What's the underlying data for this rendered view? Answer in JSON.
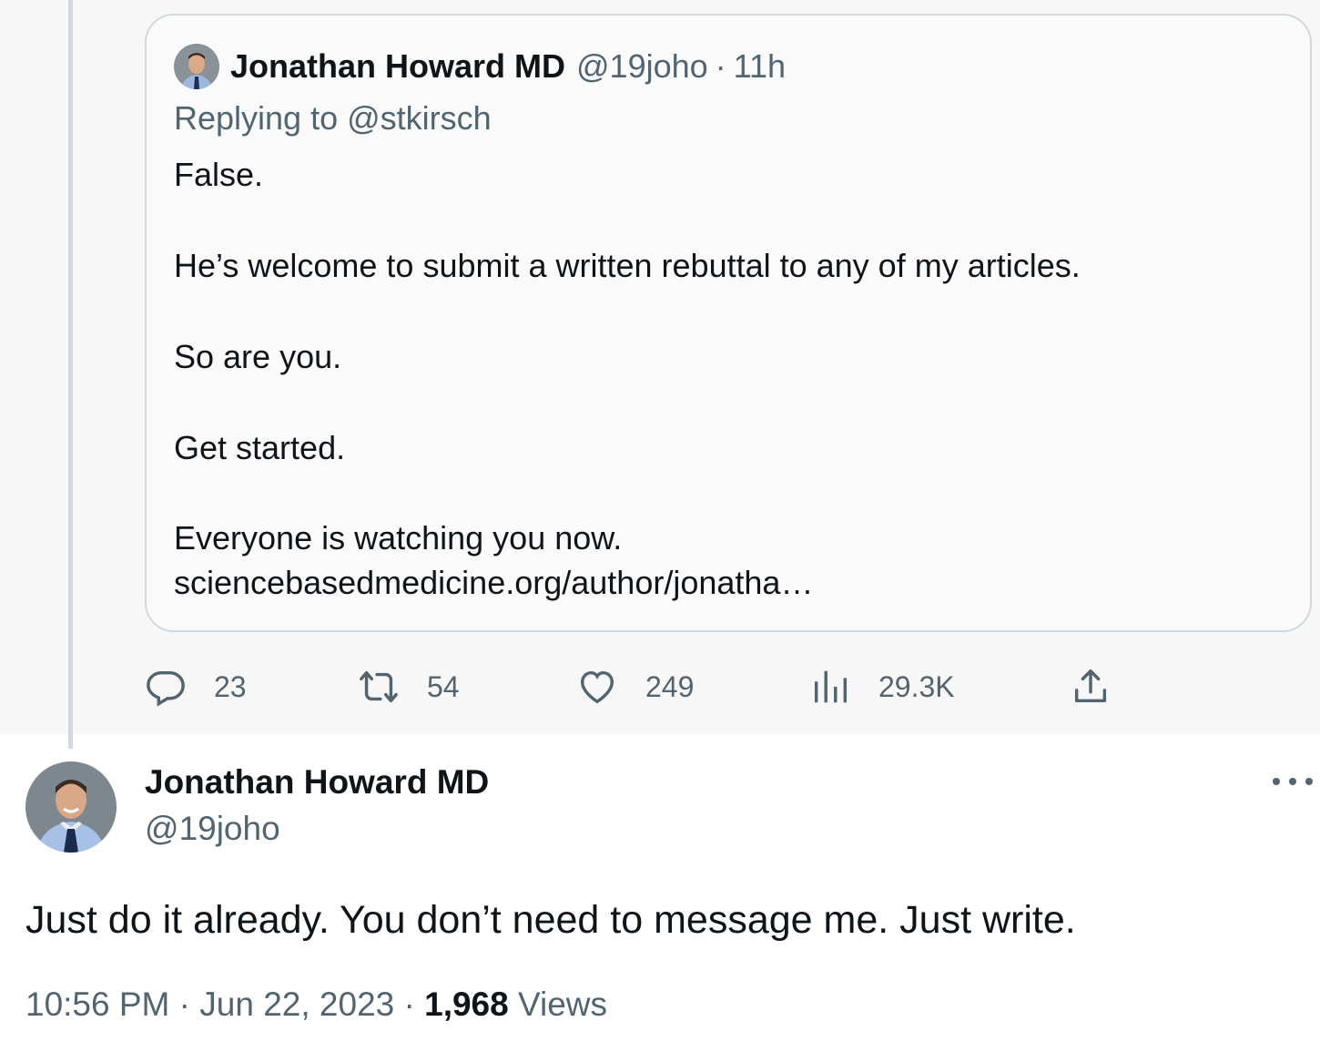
{
  "colors": {
    "text_primary": "#0f1419",
    "text_secondary": "#536471",
    "border": "#cfd9de",
    "parent_bg": "#f7f7f7"
  },
  "quoted_tweet": {
    "author_name": "Jonathan Howard MD",
    "handle": "@19joho",
    "separator": "·",
    "time": "11h",
    "replying_to": "Replying to @stkirsch",
    "lines": [
      "False.",
      "He’s welcome to submit a written rebuttal to any of my articles.",
      "So are you.",
      "Get started.",
      "Everyone is watching you now.",
      "sciencebasedmedicine.org/author/jonatha…"
    ],
    "actions": {
      "reply_count": "23",
      "repost_count": "54",
      "like_count": "249",
      "views_count": "29.3K"
    },
    "icons": [
      "reply-icon",
      "repost-icon",
      "like-icon",
      "views-icon",
      "share-icon"
    ]
  },
  "main_tweet": {
    "author_name": "Jonathan Howard MD",
    "handle": "@19joho",
    "text": "Just do it already.  You don’t need to message me.  Just write.",
    "time": "10:56 PM",
    "date": "Jun 22, 2023",
    "separator": "·",
    "views_count": "1,968",
    "views_label": "Views",
    "icons": [
      "avatar",
      "more-icon"
    ]
  }
}
